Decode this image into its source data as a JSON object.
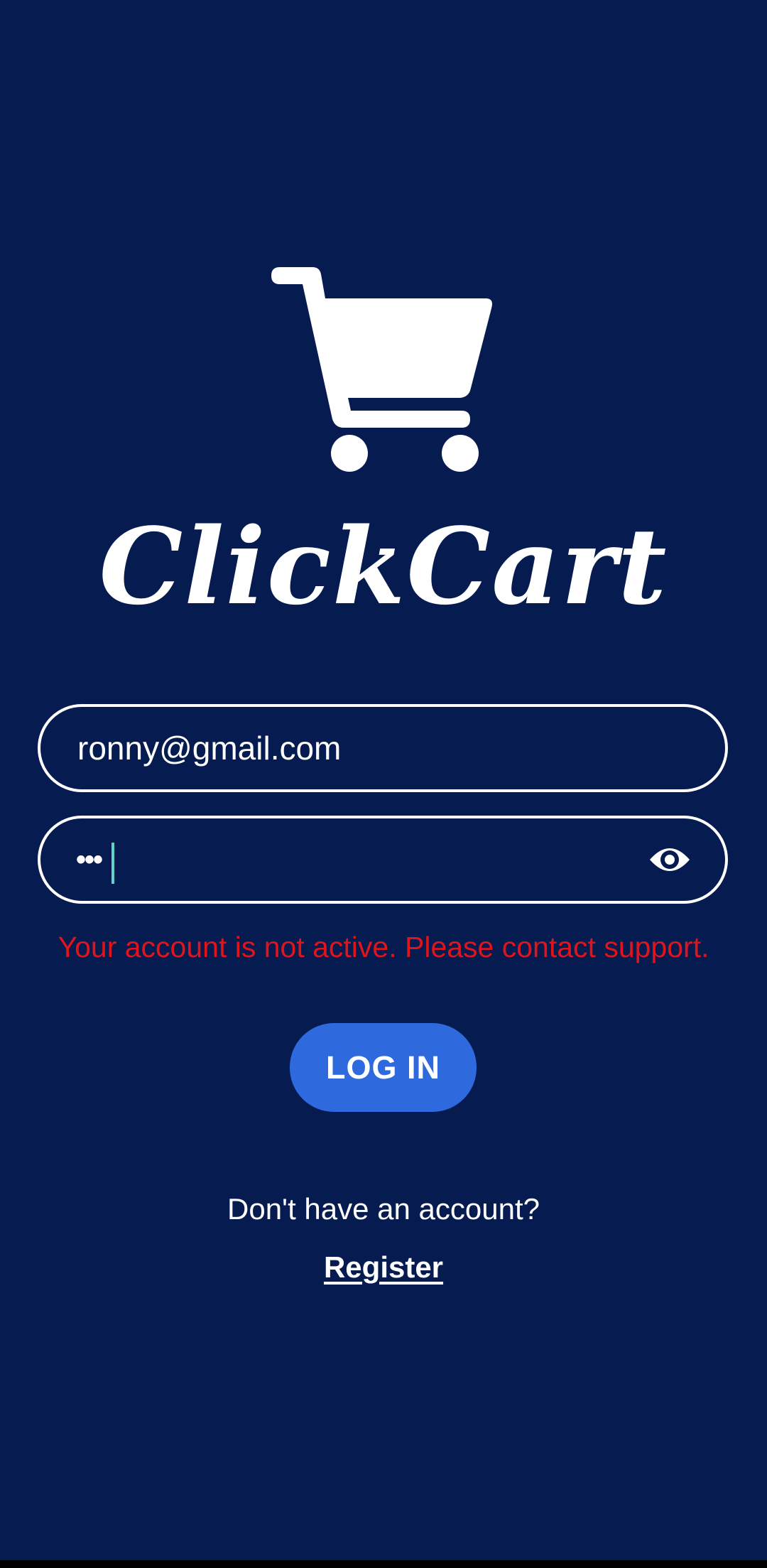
{
  "app": {
    "brand_name": "ClickCart",
    "logo_icon": "shopping-cart-icon"
  },
  "login_form": {
    "email_value": "ronny@gmail.com",
    "password_masked": "•••",
    "visibility_icon": "eye-icon",
    "error_message": "Your account is not active. Please contact support.",
    "login_label": "LOG IN"
  },
  "footer": {
    "prompt": "Don't have an account?",
    "register_label": "Register"
  },
  "colors": {
    "background": "#061b4f",
    "accent": "#2f69de",
    "error": "#e0141b",
    "text": "#ffffff",
    "caret": "#5fd3c6"
  }
}
